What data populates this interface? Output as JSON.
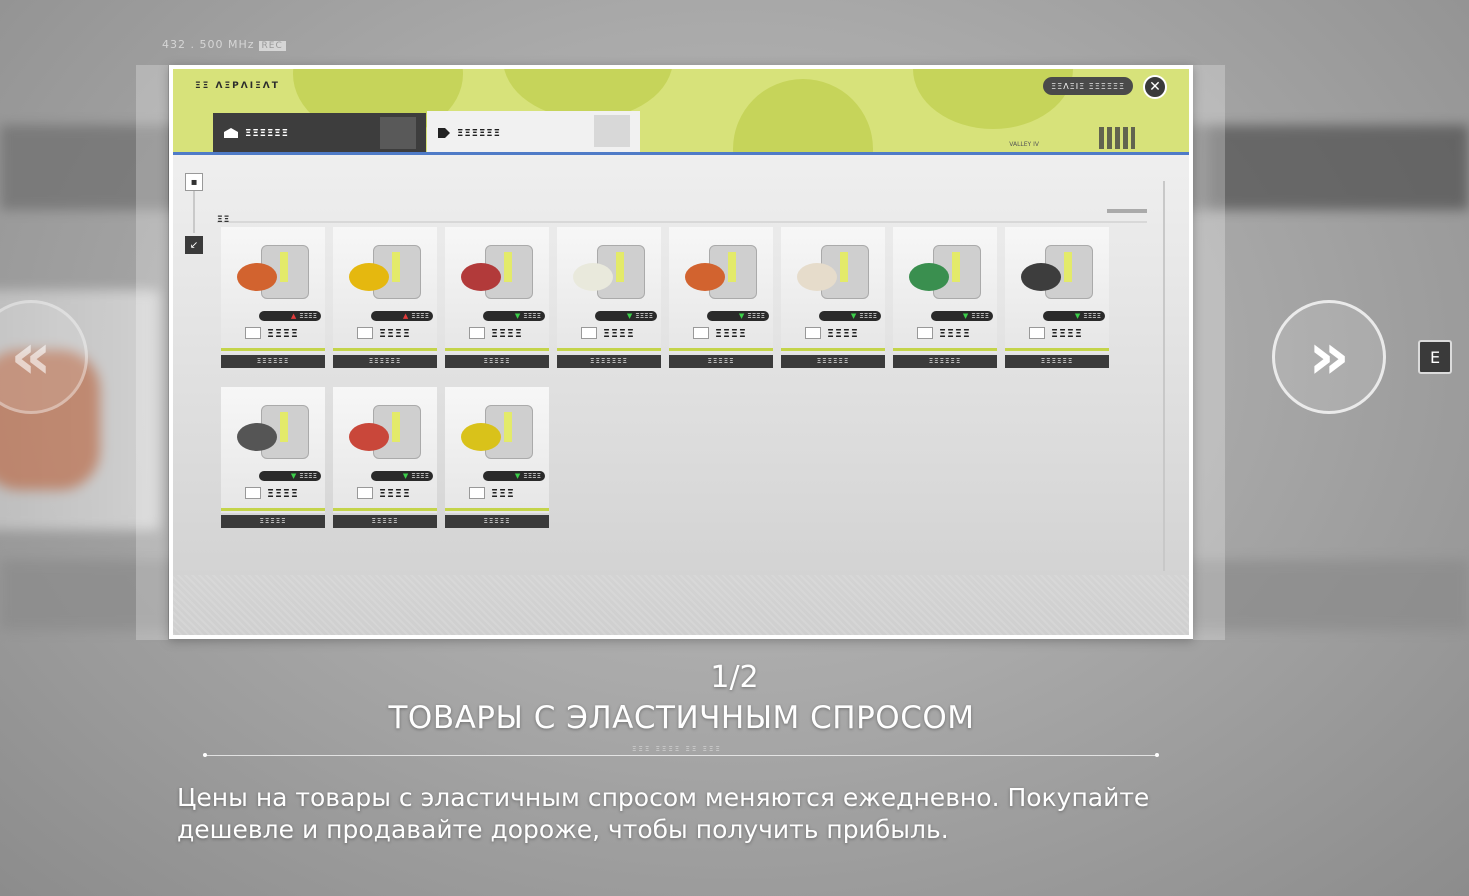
{
  "background": {
    "frequency": "432 . 500 MHz",
    "frequency_tag": "REC"
  },
  "navigation": {
    "prev_icon": "chevrons-left-icon",
    "next_icon": "chevrons-right-icon",
    "prev_glyph": "«",
    "next_glyph": "»",
    "key_hint": "E"
  },
  "screen": {
    "header_title": "ΞΞ ΛΞΡΛΙΞΛΤ",
    "balance_pill": "ΞΞΛΞΙΞ ΞΞΞΞΞΞ",
    "close_glyph": "✕",
    "brand": "VALLEY IV",
    "tabs": [
      {
        "label": "ΞΞΞΞΞΞ",
        "icon": "warehouse-icon"
      },
      {
        "label": "ΞΞΞΞΞΞ",
        "icon": "trader-icon"
      }
    ],
    "section_title": "ΞΞ",
    "products": [
      {
        "name": "ΞΞΞΞΞΞ",
        "change": "ΞΞΞΞ",
        "trend": "up",
        "price": "ΞΞΞΞ",
        "obj_color": "#d2632f"
      },
      {
        "name": "ΞΞΞΞΞΞ",
        "change": "ΞΞΞΞ",
        "trend": "up",
        "price": "ΞΞΞΞ",
        "obj_color": "#e5b80f"
      },
      {
        "name": "ΞΞΞΞΞ",
        "change": "ΞΞΞΞ",
        "trend": "down",
        "price": "ΞΞΞΞ",
        "obj_color": "#b23a3a"
      },
      {
        "name": "ΞΞΞΞΞΞΞ",
        "change": "ΞΞΞΞ",
        "trend": "down",
        "price": "ΞΞΞΞ",
        "obj_color": "#e9e9dc"
      },
      {
        "name": "ΞΞΞΞΞ",
        "change": "ΞΞΞΞ",
        "trend": "down",
        "price": "ΞΞΞΞ",
        "obj_color": "#d2632f"
      },
      {
        "name": "ΞΞΞΞΞΞ",
        "change": "ΞΞΞΞ",
        "trend": "down",
        "price": "ΞΞΞΞ",
        "obj_color": "#e6dccb"
      },
      {
        "name": "ΞΞΞΞΞΞ",
        "change": "ΞΞΞΞ",
        "trend": "down",
        "price": "ΞΞΞΞ",
        "obj_color": "#3a8f4f"
      },
      {
        "name": "ΞΞΞΞΞΞ",
        "change": "ΞΞΞΞ",
        "trend": "down",
        "price": "ΞΞΞΞ",
        "obj_color": "#3d3d3d"
      },
      {
        "name": "ΞΞΞΞΞ",
        "change": "ΞΞΞΞ",
        "trend": "down",
        "price": "ΞΞΞΞ",
        "obj_color": "#555555"
      },
      {
        "name": "ΞΞΞΞΞ",
        "change": "ΞΞΞΞ",
        "trend": "down",
        "price": "ΞΞΞΞ",
        "obj_color": "#c9473a"
      },
      {
        "name": "ΞΞΞΞΞ",
        "change": "ΞΞΞΞ",
        "trend": "down",
        "price": "ΞΞΞ",
        "obj_color": "#d9c21a"
      }
    ]
  },
  "caption": {
    "page_counter": "1/2",
    "title": "ТОВАРЫ С ЭЛАСТИЧНЫМ СПРОСОМ",
    "divider_code": "ΞΞΞ ΞΞΞΞ ΞΞ ΞΞΞ",
    "description": "Цены на товары с эластичным спросом меняются ежедневно. Покупайте дешевле и продавайте дороже, чтобы получить прибыль."
  },
  "colors": {
    "accent_lime": "#d7e27a",
    "accent_blue": "#4f7bc7",
    "trend_up": "#e23b3b",
    "trend_down": "#3ccf4a"
  }
}
